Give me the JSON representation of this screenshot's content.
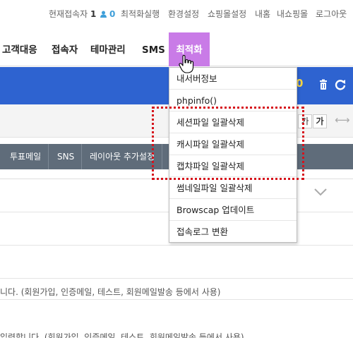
{
  "topbar": {
    "current_users_label": "현재접속자",
    "current_users_count": "1",
    "current_users_icon": "user-icon",
    "current_users_online": "0",
    "links": [
      "최적화실행",
      "환경설정",
      "쇼핑몰설정",
      "내홈",
      "내쇼핑몰",
      "로그아웃"
    ]
  },
  "nav": {
    "items": [
      "고객대응",
      "접속자",
      "테마관리",
      "SMS",
      "최적화"
    ],
    "active": "최적화",
    "active_color": "#c97be7"
  },
  "bluebar": {
    "color": "#2e63d0",
    "value": "0",
    "icons": [
      "trash-icon",
      "refresh-icon"
    ]
  },
  "font_buttons": [
    "가",
    "가"
  ],
  "subtabs": [
    "투표메일",
    "SNS",
    "레이아웃 추가설정"
  ],
  "dropdown": {
    "items": [
      "내서버정보",
      "phpinfo()",
      "세션파일 일괄삭제",
      "캐시파일 일괄삭제",
      "캡챠파일 일괄삭제",
      "썸네일파일 일괄삭제",
      "Browscap 업데이트",
      "접속로그 변환"
    ],
    "highlighted_items": [
      "세션파일 일괄삭제",
      "캐시파일 일괄삭제",
      "캡챠파일 일괄삭제"
    ],
    "highlight_color": "#d6121b"
  },
  "content": {
    "desc1": "니다. (회원가입, 인증메일, 테스트, 회원메일발송 등에서 사용)",
    "desc2": "입력합니다. (회원가입, 인증메일, 테스트, 회원메일발송 등에서 사용)"
  }
}
